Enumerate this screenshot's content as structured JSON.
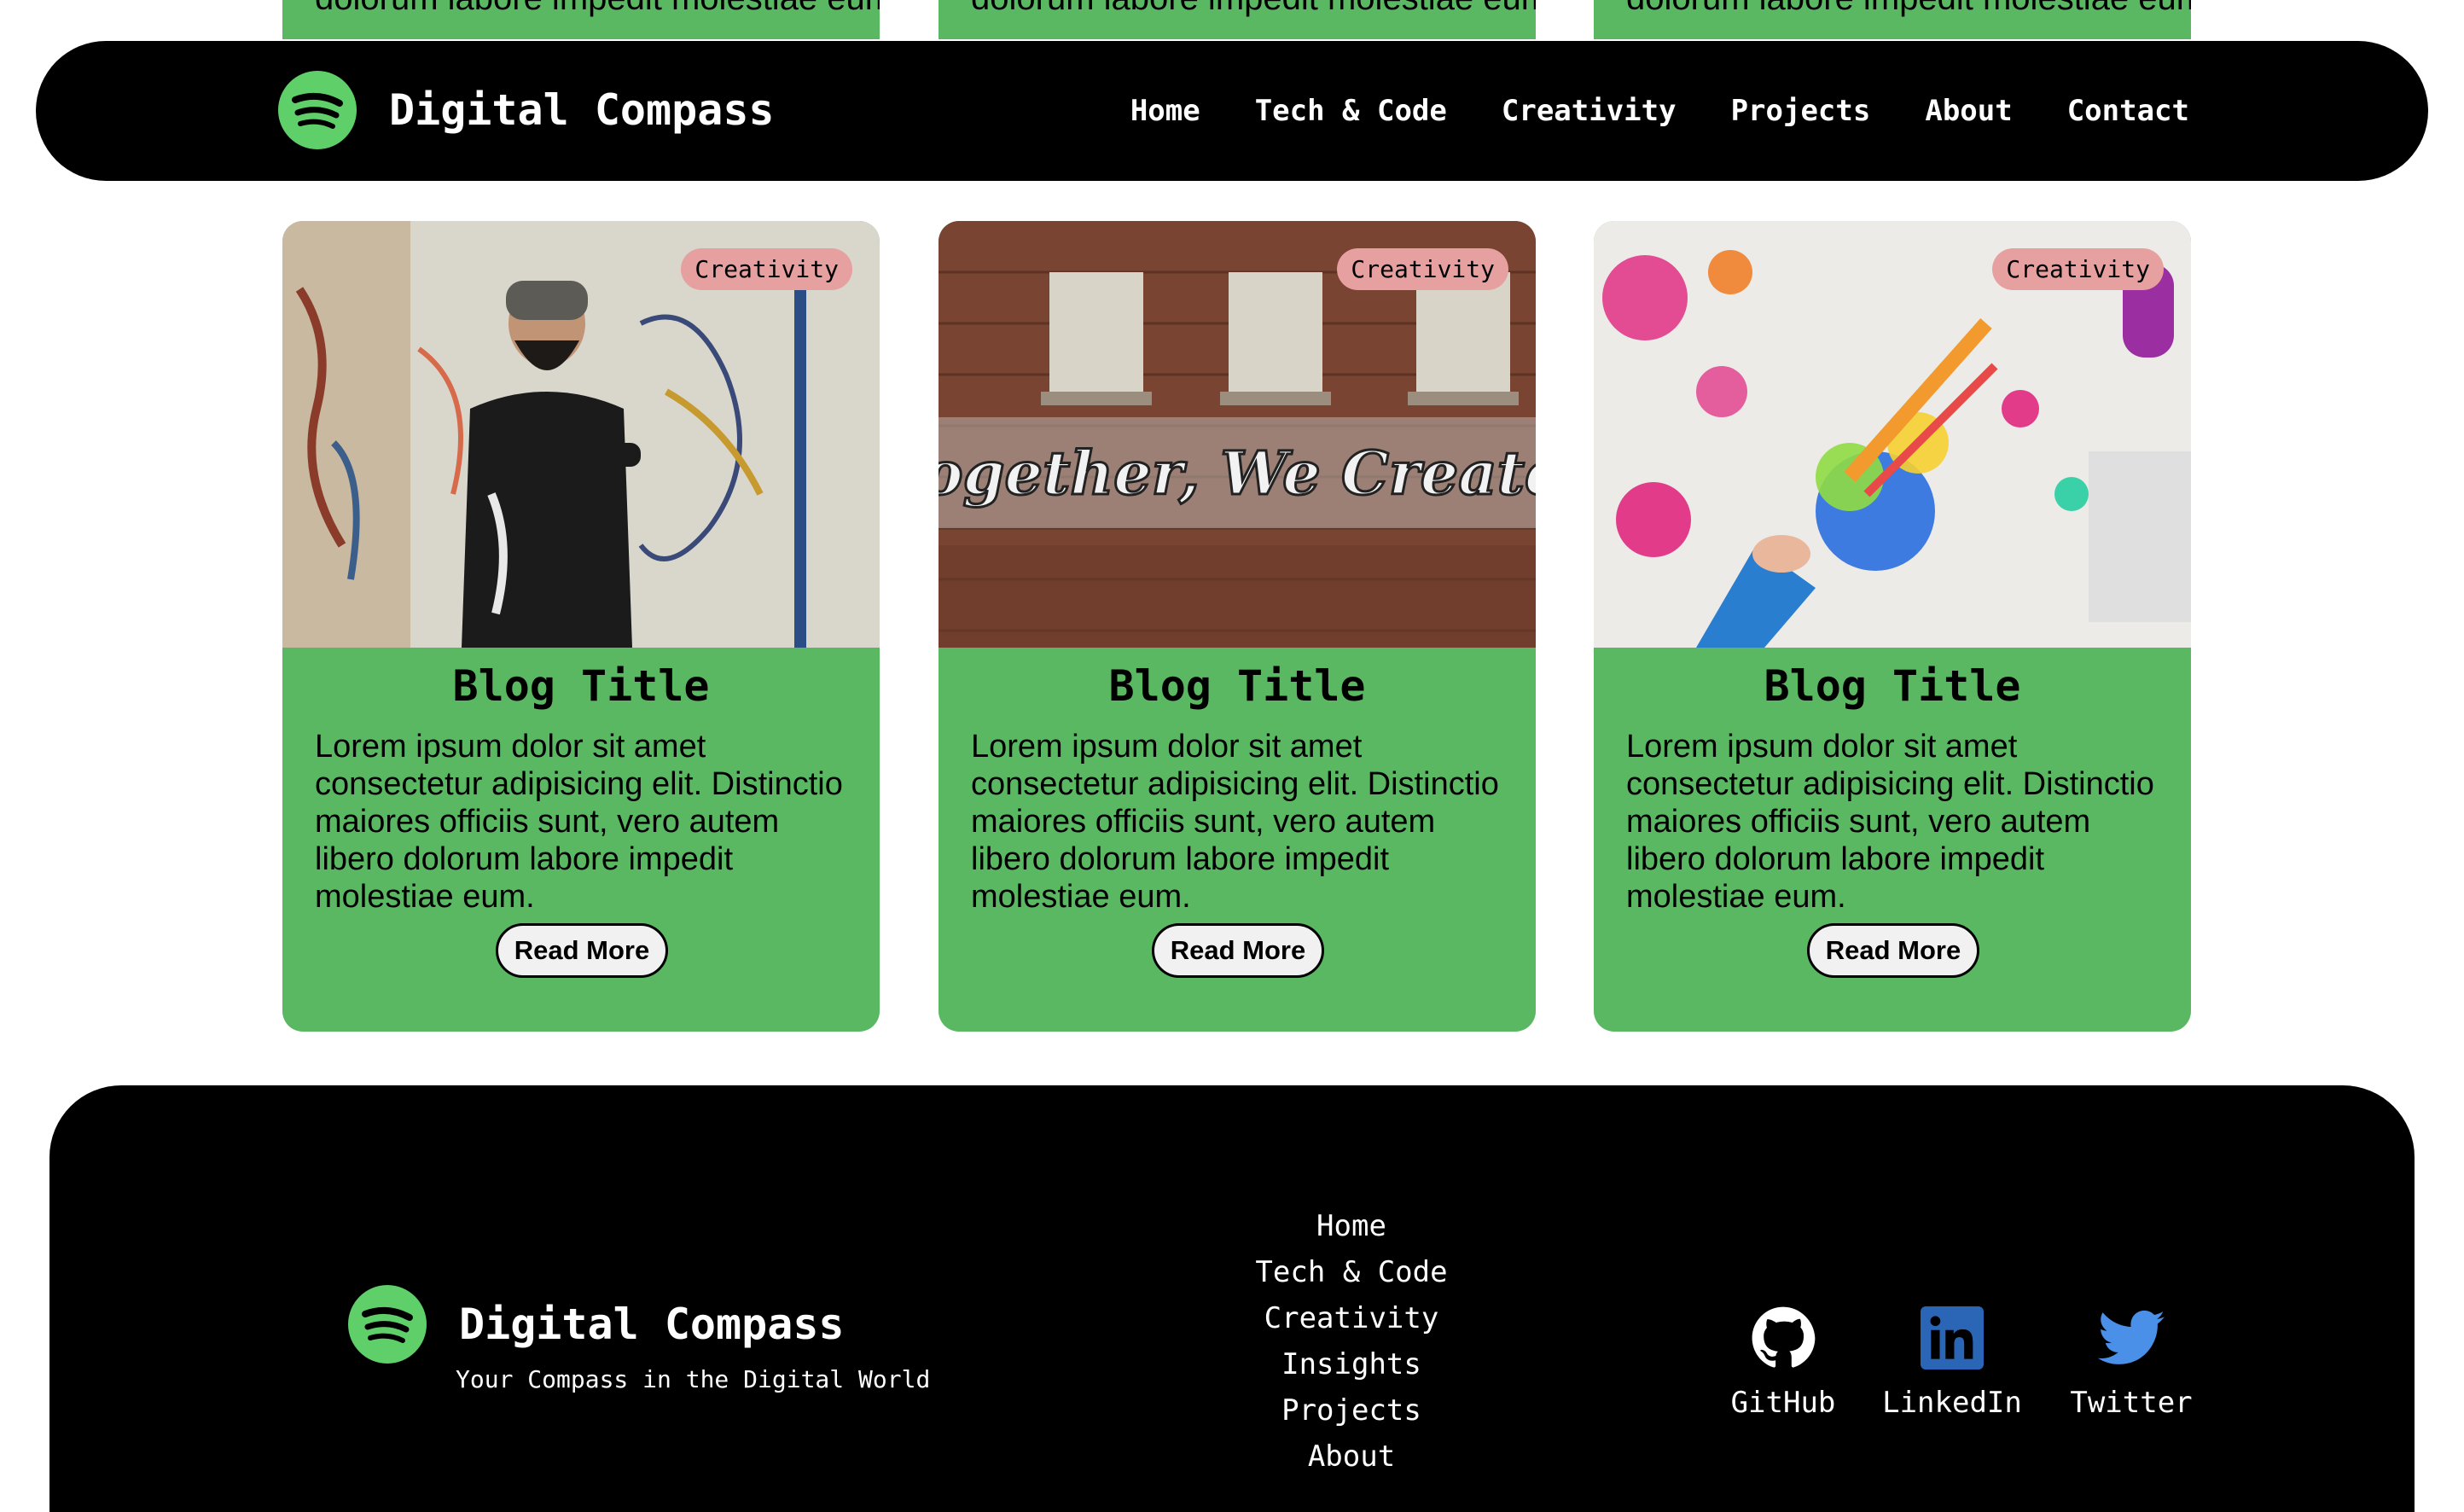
{
  "colors": {
    "card_green": "#5bb862",
    "tag_pink": "#e6a0a0",
    "header_bg": "#000000",
    "spotify_green": "#5fcf6a"
  },
  "peek_text": "dolorum labore impedit molestiae eum.",
  "header": {
    "brand": "Digital Compass",
    "logo_icon": "spotify-like-logo-icon",
    "nav": [
      "Home",
      "Tech & Code",
      "Creativity",
      "Projects",
      "About",
      "Contact"
    ]
  },
  "cards": [
    {
      "tag": "Creativity",
      "image": "artist-painting-wall-photo",
      "title": "Blog Title",
      "text": "Lorem ipsum dolor sit amet consectetur adipisicing elit. Distinctio maiores officiis sunt, vero autem libero dolorum labore impedit molestiae eum.",
      "button": "Read More"
    },
    {
      "tag": "Creativity",
      "image": "brick-wall-graffiti-photo",
      "image_text": "Together, We Create!",
      "title": "Blog Title",
      "text": "Lorem ipsum dolor sit amet consectetur adipisicing elit. Distinctio maiores officiis sunt, vero autem libero dolorum labore impedit molestiae eum.",
      "button": "Read More"
    },
    {
      "tag": "Creativity",
      "image": "paint-splatter-photo",
      "title": "Blog Title",
      "text": "Lorem ipsum dolor sit amet consectetur adipisicing elit. Distinctio maiores officiis sunt, vero autem libero dolorum labore impedit molestiae eum.",
      "button": "Read More"
    }
  ],
  "footer": {
    "brand": "Digital Compass",
    "tagline": "Your Compass in the Digital World",
    "links": [
      "Home",
      "Tech & Code",
      "Creativity",
      "Insights",
      "Projects",
      "About"
    ],
    "social": [
      {
        "label": "GitHub",
        "icon": "github-icon"
      },
      {
        "label": "LinkedIn",
        "icon": "linkedin-icon"
      },
      {
        "label": "Twitter",
        "icon": "twitter-icon"
      }
    ]
  }
}
